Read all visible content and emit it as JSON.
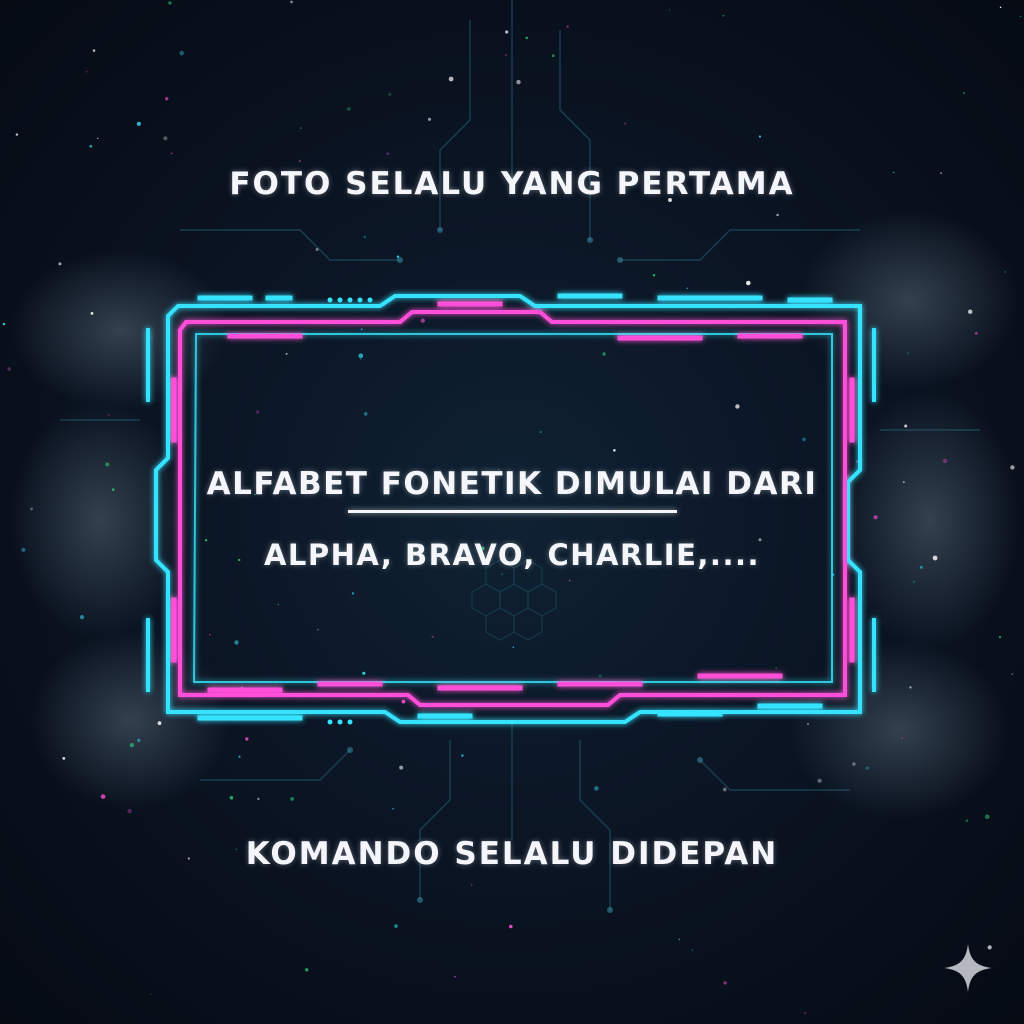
{
  "captions": {
    "top": "FOTO SELALU YANG PERTAMA",
    "headline": "ALFABET FONETIK DIMULAI DARI",
    "subline": "ALPHA, BRAVO, CHARLIE,....",
    "bottom": "KOMANDO SELALU DIDEPAN"
  },
  "colors": {
    "background": "#0a1322",
    "cyan": "#35e3ff",
    "magenta": "#ff4fd8",
    "text": "#f4f6fb",
    "particles": "#2bd67b"
  },
  "icons": [
    "hud-frame",
    "circuit-lines",
    "hexagon-pattern",
    "smoke",
    "sparkle-icon"
  ]
}
